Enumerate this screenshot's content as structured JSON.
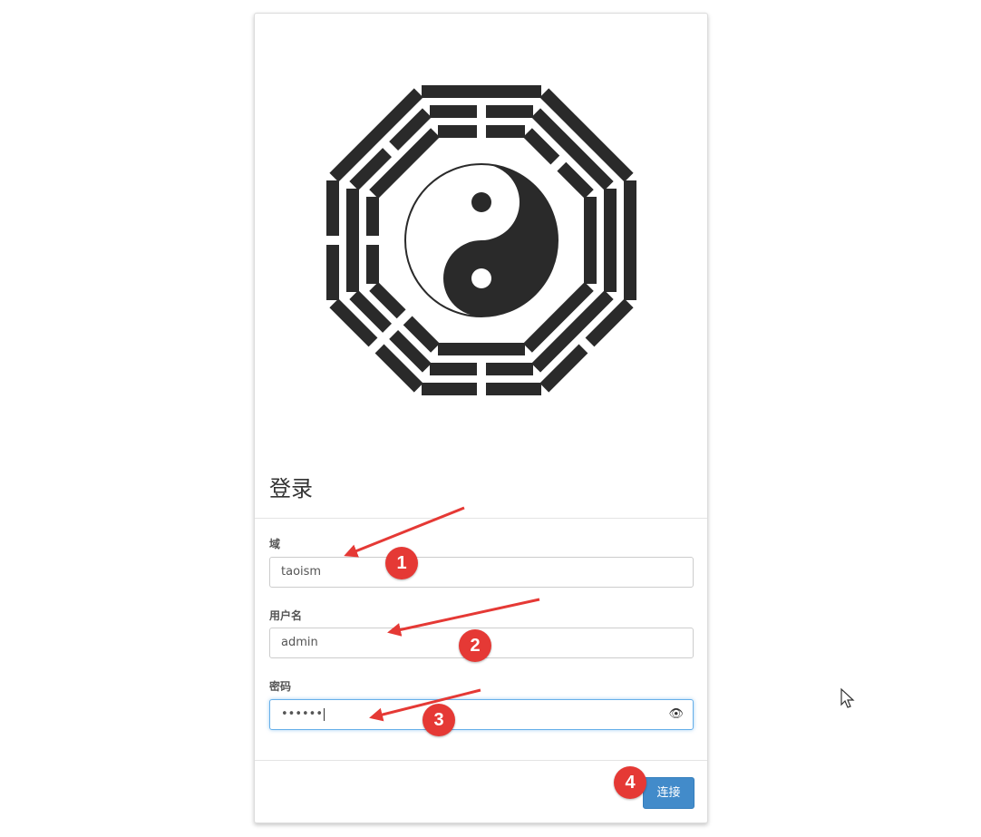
{
  "login": {
    "title": "登录",
    "fields": [
      {
        "label": "域",
        "value": "taoism"
      },
      {
        "label": "用户名",
        "value": "admin"
      },
      {
        "label": "密码",
        "value": "••••••"
      }
    ],
    "connect_label": "连接"
  },
  "annotations": {
    "markers": [
      "1",
      "2",
      "3",
      "4"
    ],
    "color": "#e53935"
  },
  "icons": {
    "logo": "bagua-taiji-logo",
    "password_toggle": "eye-icon",
    "cursor": "mouse-pointer-icon"
  }
}
